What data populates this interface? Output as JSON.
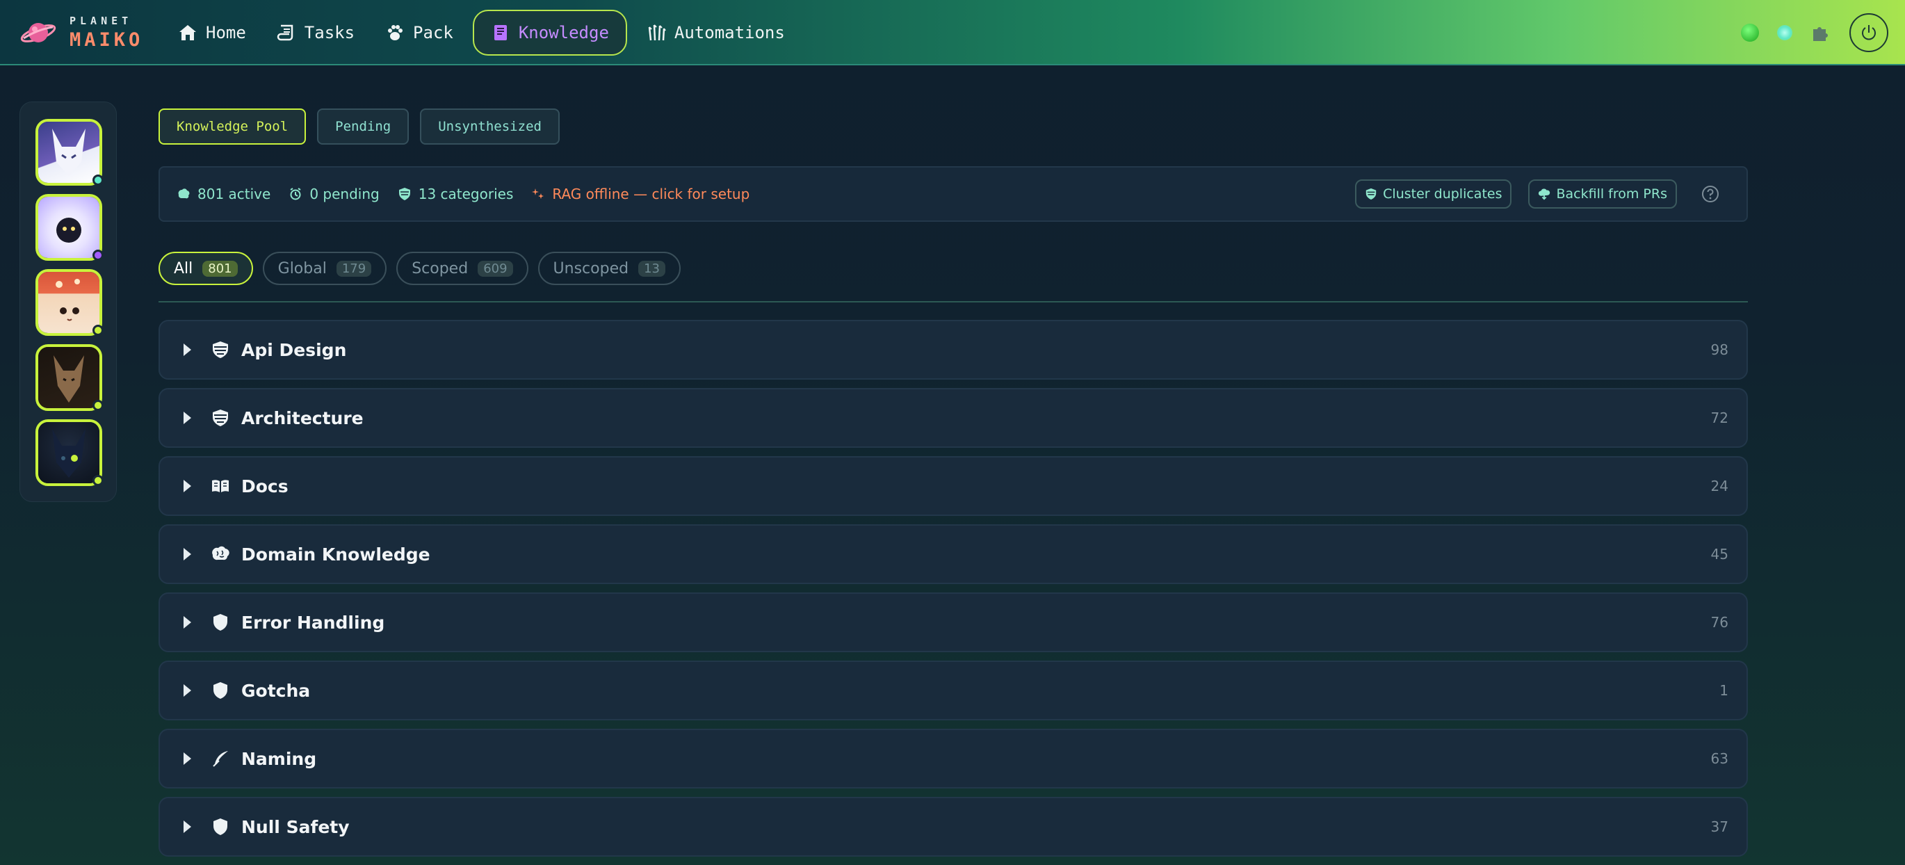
{
  "brand": {
    "top": "PLANET",
    "bottom": "MAIKO"
  },
  "nav": [
    {
      "label": "Home",
      "icon": "home-icon",
      "active": false
    },
    {
      "label": "Tasks",
      "icon": "scroll-icon",
      "active": false
    },
    {
      "label": "Pack",
      "icon": "paw-icon",
      "active": false
    },
    {
      "label": "Knowledge",
      "icon": "book-icon",
      "active": true
    },
    {
      "label": "Automations",
      "icon": "claw-icon",
      "active": false
    }
  ],
  "status_indicators": {
    "primary": "green-status-dot",
    "secondary": "cyan-status-dot"
  },
  "agents": [
    {
      "name": "white-fox",
      "status_color": "#5ee8c9"
    },
    {
      "name": "fluffy-spirit",
      "status_color": "#a45cff"
    },
    {
      "name": "mushroom-girl",
      "status_color": "#c8f23c"
    },
    {
      "name": "brown-wolf",
      "status_color": "#c8f23c"
    },
    {
      "name": "dark-wolf",
      "status_color": "#c8f23c"
    }
  ],
  "tabs": [
    {
      "label": "Knowledge Pool",
      "active": true
    },
    {
      "label": "Pending",
      "active": false
    },
    {
      "label": "Unsynthesized",
      "active": false
    }
  ],
  "stats": {
    "active": "801 active",
    "pending": "0 pending",
    "categories": "13 categories",
    "rag": "RAG offline — click for setup"
  },
  "actions": {
    "cluster": "Cluster duplicates",
    "backfill": "Backfill from PRs"
  },
  "filters": [
    {
      "label": "All",
      "count": "801",
      "active": true
    },
    {
      "label": "Global",
      "count": "179",
      "active": false
    },
    {
      "label": "Scoped",
      "count": "609",
      "active": false
    },
    {
      "label": "Unscoped",
      "count": "13",
      "active": false
    }
  ],
  "categories": [
    {
      "label": "Api Design",
      "count": "98",
      "icon": "shield-stripes-icon"
    },
    {
      "label": "Architecture",
      "count": "72",
      "icon": "shield-stripes-icon"
    },
    {
      "label": "Docs",
      "count": "24",
      "icon": "open-book-icon"
    },
    {
      "label": "Domain Knowledge",
      "count": "45",
      "icon": "brain-icon"
    },
    {
      "label": "Error Handling",
      "count": "76",
      "icon": "shield-icon"
    },
    {
      "label": "Gotcha",
      "count": "1",
      "icon": "shield-icon"
    },
    {
      "label": "Naming",
      "count": "63",
      "icon": "quill-icon"
    },
    {
      "label": "Null Safety",
      "count": "37",
      "icon": "shield-icon"
    }
  ],
  "colors": {
    "accent": "#c8f23c",
    "knowledge_active": "#c58cff",
    "stat_text": "#8fe6cc",
    "warning": "#ff8a5a"
  }
}
